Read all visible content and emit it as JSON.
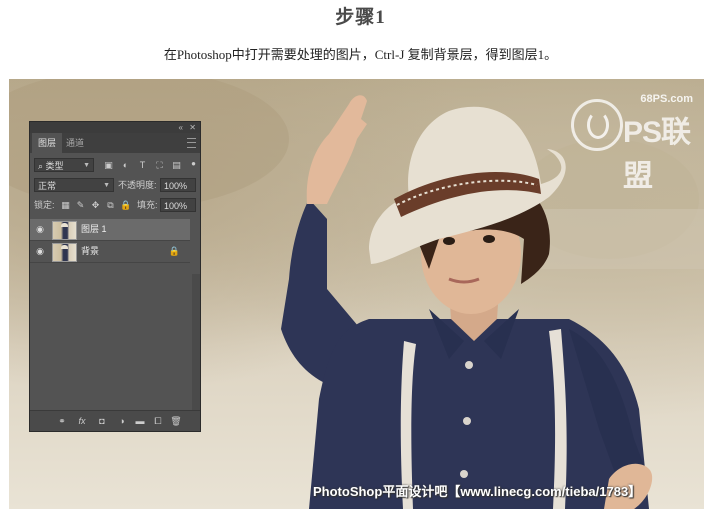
{
  "page": {
    "step_title": "步骤1",
    "instruction": "在Photoshop中打开需要处理的图片，Ctrl-J 复制背景层，得到图层1。"
  },
  "watermark": {
    "site": "68PS.com",
    "brand": "PS联盟",
    "bottom_text": "PhotoShop平面设计吧【www.linecg.com/tieba/1783】"
  },
  "panel": {
    "collapse_icon": "«",
    "close_icon": "✕",
    "tabs": [
      {
        "label": "图层",
        "active": true
      },
      {
        "label": "通道",
        "active": false
      }
    ],
    "filter": {
      "label": "类型",
      "icons": [
        "▣",
        "◐",
        "T",
        "⛶",
        "▤"
      ]
    },
    "blend_mode": "正常",
    "opacity_label": "不透明度:",
    "opacity_value": "100%",
    "lock_label": "锁定:",
    "lock_icons": [
      "▦",
      "✎",
      "✥",
      "⧉",
      "🔒"
    ],
    "fill_label": "填充:",
    "fill_value": "100%",
    "layers": [
      {
        "name": "图层 1",
        "selected": true,
        "locked": false
      },
      {
        "name": "背景",
        "selected": false,
        "locked": true
      }
    ],
    "bottom_icons": [
      "⚭",
      "fx",
      "◘",
      "◑",
      "▬",
      "⧠",
      "🗑"
    ]
  },
  "colors": {
    "panel_bg": "#535353",
    "selected_layer": "#6b6b6b",
    "shirt": "#2e3556"
  }
}
